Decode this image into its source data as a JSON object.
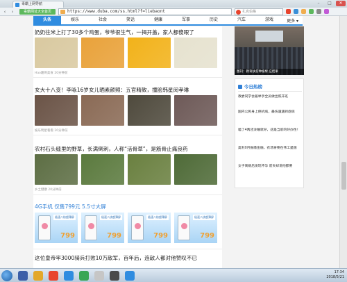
{
  "browser": {
    "tab_title": "毒霸上网导航",
    "url": "https://www.duba.com/ss.html?f=liebaont",
    "home_label": "毒霸网址大全首页",
    "search_placeholder": "扎克伯格",
    "win_controls": [
      "–",
      "□",
      "✕"
    ]
  },
  "nav": {
    "items": [
      "头条",
      "娱乐",
      "社会",
      "笑话",
      "健康",
      "军事",
      "历史",
      "汽车",
      "游戏"
    ],
    "active_index": 0,
    "more_label": "更多"
  },
  "feed": {
    "articles": [
      {
        "title": "奶奶往米上打了30多个鸡蛋，爷爷很生气，一揭开盖，家人都傻眼了",
        "meta": "Hao趣哥美食  20分钟前",
        "thumb_colors": [
          "#d9c9a0",
          "#e9a23a",
          "#f2b21a",
          "#e6e2cf"
        ]
      },
      {
        "title": "女大十八变！李咏16岁女儿晒素颜照：五官精致，撞脸韩星闵孝琳",
        "meta": "娱乐明星看看  20分钟前",
        "thumb_colors": [
          "#6b5447",
          "#8a6a55",
          "#4f4a3d",
          "#6e5a58"
        ]
      },
      {
        "title": "农村石头缝里的野草，长满倒刺，人称“活骨草”，是筋骨止痛良药",
        "meta": "乡土健康  20分钟前",
        "thumb_colors": [
          "#5d6e44",
          "#5b7a3e",
          "#6a8040",
          "#4f6b38"
        ]
      }
    ],
    "ad": {
      "title": "4G手机 仅售799元 5.5寸大屏",
      "banner": "极速八核超薄屏",
      "price": "799",
      "count": 5
    },
    "last_title": "这位皇帝率3000骑兵打败10万敌军，百年后，连敌人都对他赞叹不已"
  },
  "sidebar": {
    "photo_caption": "图刊：教育扶贫种植黎 应结果",
    "hot_title": "今日热榜",
    "hot_items": [
      "教委同学会着举手全员做出照开班",
      "国内公民身上癌机病，最伤遇遇到症病",
      "嗑了4两还没睡就好，这是当前的好办性！",
      "奥利0月报缴金融，农场将要在伟工是施",
      "女子离婚后发现怀孕 前夫却说他都要"
    ]
  },
  "taskbar": {
    "time": "17:34",
    "date": "2018/5/21"
  },
  "colors": {
    "accent": "#2f8ce0",
    "ad_title": "#2f7fd6",
    "price": "#f0a030"
  }
}
